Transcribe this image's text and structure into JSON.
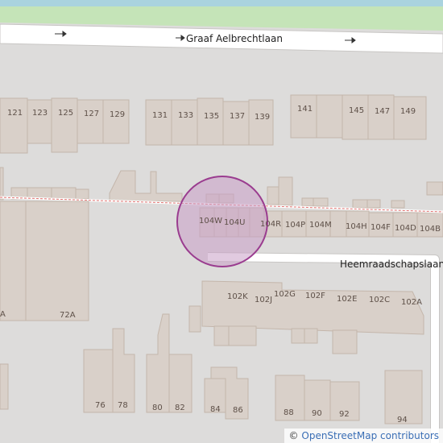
{
  "streets": {
    "top": "Graaf Aelbrechtlaan",
    "right": "Heemraadschapslaan"
  },
  "house_numbers": {
    "top_row": [
      "121",
      "123",
      "125",
      "127",
      "129",
      "131",
      "133",
      "135",
      "137",
      "139",
      "141",
      "145",
      "147",
      "149"
    ],
    "middle_row": [
      "104W",
      "104U",
      "104R",
      "104P",
      "104M",
      "104H",
      "104F",
      "104D",
      "104B"
    ],
    "lower_row": [
      "102K",
      "102J",
      "102G",
      "102F",
      "102E",
      "102C",
      "102A"
    ],
    "left": [
      "A",
      "72A"
    ],
    "bottom_row": [
      "76",
      "78",
      "80",
      "82",
      "84",
      "86",
      "88",
      "90",
      "92",
      "94"
    ]
  },
  "attribution": {
    "symbol": "©",
    "text": "OpenStreetMap contributors"
  },
  "colors": {
    "background": "#dddcdb",
    "building": "#d9d0c9",
    "building_outline": "#c4b6ab",
    "road": "#ffffff",
    "grass": "#c5e4b8",
    "water": "#aad3df",
    "railway_dash": "#e0706e",
    "marker_fill": "#c89fc7",
    "marker_stroke": "#9a3c8f"
  }
}
